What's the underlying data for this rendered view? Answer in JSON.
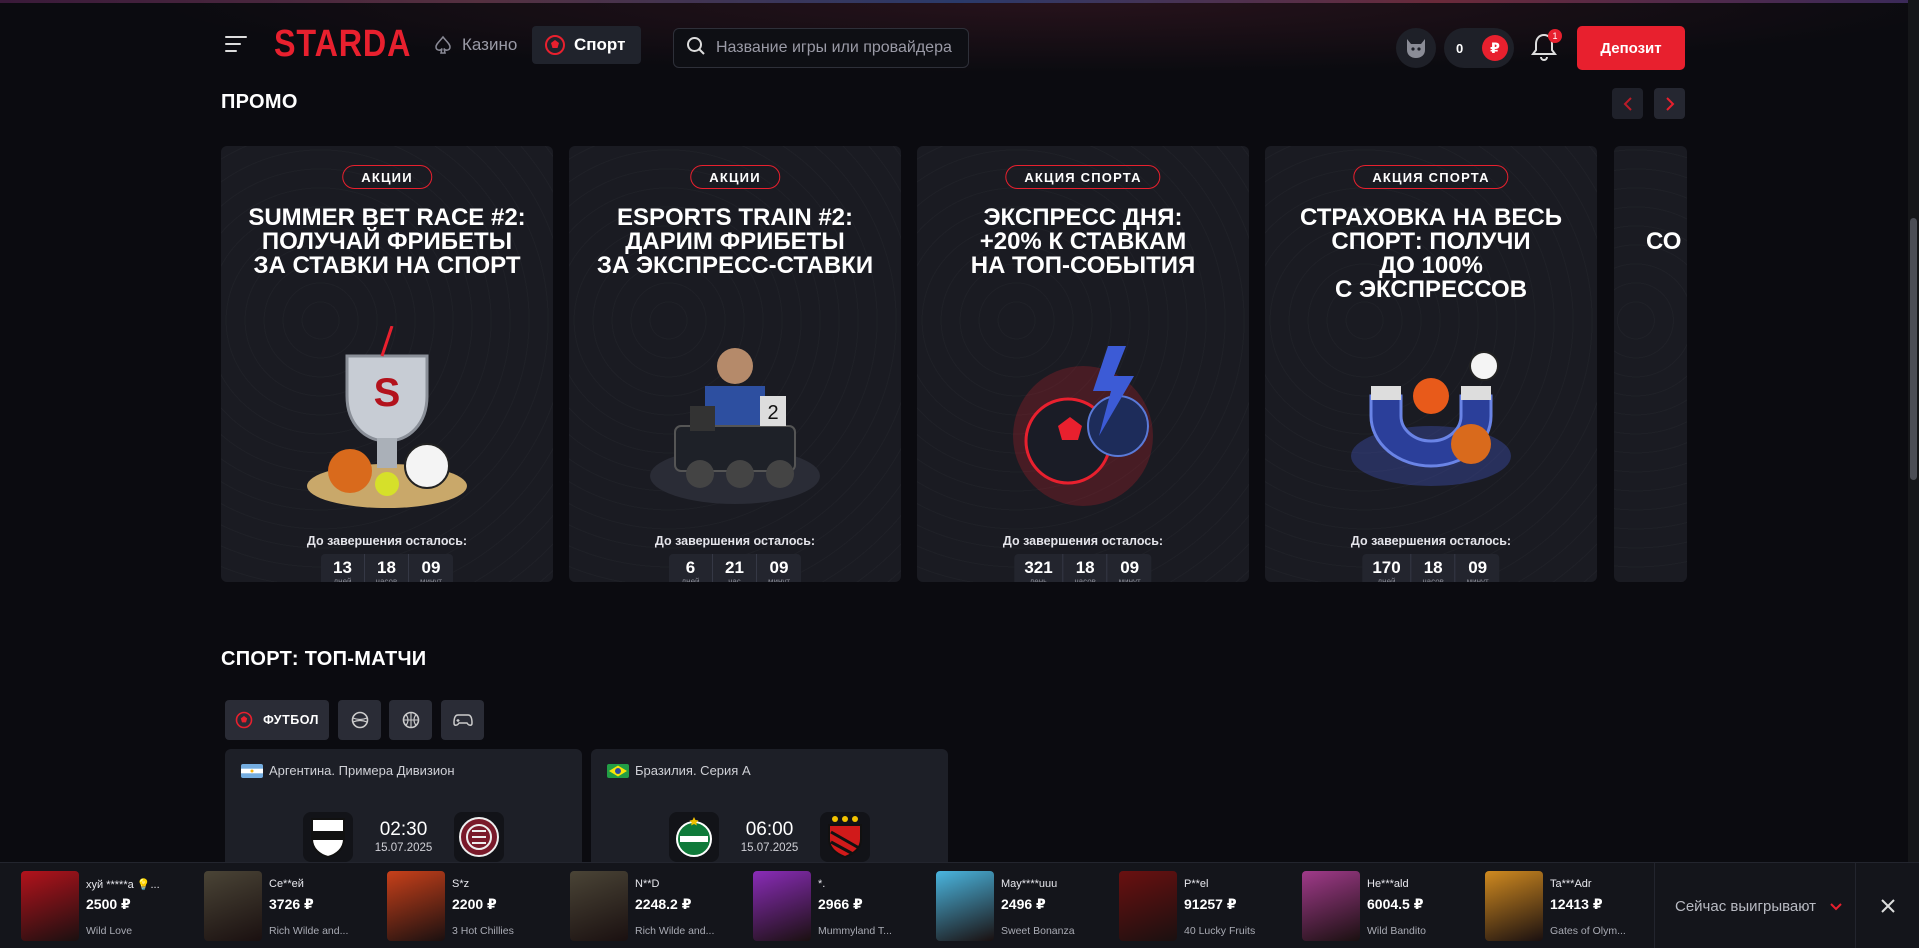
{
  "header": {
    "logo": "STARDA",
    "nav": {
      "casino": "Казино",
      "sport": "Спорт"
    },
    "search_placeholder": "Название игры или провайдера",
    "balance": "0",
    "currency": "₽",
    "notifications_count": "1",
    "deposit_label": "Депозит"
  },
  "promo": {
    "title": "ПРОМО",
    "cards": [
      {
        "badge": "АКЦИИ",
        "title": "SUMMER BET RACE #2:\nПОЛУЧАЙ ФРИБЕТЫ\nЗА СТАВКИ НА СПОРТ",
        "art": "trophy-sports-balls-icon",
        "timer_label": "До завершения осталось:",
        "timer": [
          {
            "value": "13",
            "unit": "дней"
          },
          {
            "value": "18",
            "unit": "часов"
          },
          {
            "value": "09",
            "unit": "минут"
          }
        ]
      },
      {
        "badge": "АКЦИИ",
        "title": "ESPORTS TRAIN #2:\nДАРИМ ФРИБЕТЫ\nЗА ЭКСПРЕСС-СТАВКИ",
        "art": "esports-train-icon",
        "timer_label": "До завершения осталось:",
        "timer": [
          {
            "value": "6",
            "unit": "дней"
          },
          {
            "value": "21",
            "unit": "час"
          },
          {
            "value": "09",
            "unit": "минут"
          }
        ]
      },
      {
        "badge": "АКЦИЯ СПОРТА",
        "title": "ЭКСПРЕСС ДНЯ:\n+20% К СТАВКАМ\nНА ТОП-СОБЫТИЯ",
        "art": "lightning-ball-icon",
        "timer_label": "До завершения осталось:",
        "timer": [
          {
            "value": "321",
            "unit": "день"
          },
          {
            "value": "18",
            "unit": "часов"
          },
          {
            "value": "09",
            "unit": "минут"
          }
        ]
      },
      {
        "badge": "АКЦИЯ СПОРТА",
        "title": "СТРАХОВКА НА ВЕСЬ\nСПОРТ: ПОЛУЧИ\nДО 100%\nС ЭКСПРЕССОВ",
        "art": "magnet-balls-icon",
        "timer_label": "До завершения осталось:",
        "timer": [
          {
            "value": "170",
            "unit": "дней"
          },
          {
            "value": "18",
            "unit": "часов"
          },
          {
            "value": "09",
            "unit": "минут"
          }
        ]
      },
      {
        "badge": "",
        "title": "СО",
        "art": "",
        "timer_label": "",
        "timer": []
      }
    ]
  },
  "sport": {
    "title": "СПОРТ: ТОП-МАТЧИ",
    "tabs": [
      {
        "label": "ФУТБОЛ",
        "icon": "football-icon"
      },
      {
        "label": "",
        "icon": "tennis-icon"
      },
      {
        "label": "",
        "icon": "basketball-icon"
      },
      {
        "label": "",
        "icon": "gamepad-icon"
      }
    ],
    "matches": [
      {
        "league": "Аргентина. Примера Дивизион",
        "time": "02:30",
        "date": "15.07.2025"
      },
      {
        "league": "Бразилия. Серия А",
        "time": "06:00",
        "date": "15.07.2025"
      }
    ]
  },
  "winners": {
    "items": [
      {
        "user": "хуй *****а 💡...",
        "amount": "2500 ₽",
        "game": "Wild Love",
        "color": "#b3121c"
      },
      {
        "user": "Се**ей",
        "amount": "3726 ₽",
        "game": "Rich Wilde and...",
        "color": "#4a4436"
      },
      {
        "user": "S*z",
        "amount": "2200 ₽",
        "game": "3 Hot Chillies",
        "color": "#c8401a"
      },
      {
        "user": "N**D",
        "amount": "2248.2 ₽",
        "game": "Rich Wilde and...",
        "color": "#4a4436"
      },
      {
        "user": "*.",
        "amount": "2966 ₽",
        "game": "Mummyland T...",
        "color": "#8a2cb8"
      },
      {
        "user": "May****uuu",
        "amount": "2496 ₽",
        "game": "Sweet Bonanza",
        "color": "#4ab6e0"
      },
      {
        "user": "P**el",
        "amount": "91257 ₽",
        "game": "40 Lucky Fruits",
        "color": "#6a1010"
      },
      {
        "user": "He***ald",
        "amount": "6004.5 ₽",
        "game": "Wild Bandito",
        "color": "#a03a8a"
      },
      {
        "user": "Ta***Adr",
        "amount": "12413 ₽",
        "game": "Gates of Olym...",
        "color": "#d08a20"
      }
    ],
    "now_winning": "Сейчас выигрывают"
  }
}
